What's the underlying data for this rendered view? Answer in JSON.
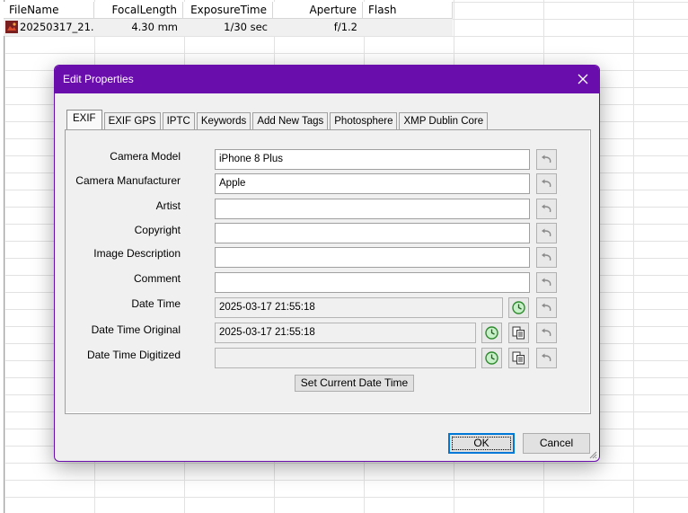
{
  "table": {
    "columns": [
      "FileName",
      "FocalLength",
      "ExposureTime",
      "Aperture",
      "Flash"
    ],
    "row": {
      "filename": "20250317_21...",
      "focal_length": "4.30 mm",
      "exposure_time": "1/30 sec",
      "aperture": "f/1.2",
      "flash": ""
    }
  },
  "dialog": {
    "title": "Edit Properties",
    "tabs": [
      "EXIF",
      "EXIF GPS",
      "IPTC",
      "Keywords",
      "Add New Tags",
      "Photosphere",
      "XMP Dublin Core"
    ],
    "active_tab": "EXIF",
    "fields": {
      "camera_model": {
        "label": "Camera Model",
        "value": "iPhone 8 Plus"
      },
      "camera_manufacturer": {
        "label": "Camera Manufacturer",
        "value": "Apple"
      },
      "artist": {
        "label": "Artist",
        "value": ""
      },
      "copyright": {
        "label": "Copyright",
        "value": ""
      },
      "image_description": {
        "label": "Image Description",
        "value": ""
      },
      "comment": {
        "label": "Comment",
        "value": ""
      },
      "date_time": {
        "label": "Date Time",
        "value": "2025-03-17 21:55:18"
      },
      "date_time_original": {
        "label": "Date Time Original",
        "value": "2025-03-17 21:55:18"
      },
      "date_time_digitized": {
        "label": "Date Time Digitized",
        "value": ""
      }
    },
    "set_current_date_label": "Set Current Date Time",
    "ok_label": "OK",
    "cancel_label": "Cancel",
    "icons": {
      "undo": "undo-arrow-icon",
      "clock": "clock-icon",
      "copy": "copy-icon",
      "close": "close-icon"
    }
  },
  "colors": {
    "accent": "#6a0dad",
    "clock_green": "#2e8b2e"
  }
}
